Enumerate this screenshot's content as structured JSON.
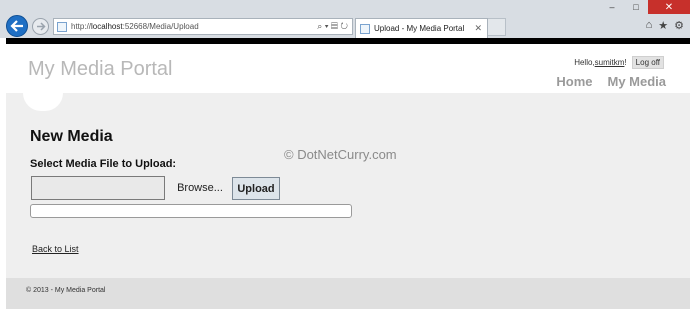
{
  "browser": {
    "url_prefix": "http://",
    "url_host": "localhost",
    "url_rest": ":52668/Media/Upload",
    "tab_title": "Upload - My Media Portal",
    "tab_close": "✕",
    "addr_tools": "⌕ ▾ ▤ ↻",
    "win_min": "–",
    "win_max": "□",
    "win_close": "✕",
    "icon_home": "⌂",
    "icon_star": "★",
    "icon_gear": "⚙"
  },
  "site": {
    "title": "My Media Portal",
    "greeting": "Hello, ",
    "user": "sumitkm",
    "greeting_end": "!",
    "logoff": "Log off",
    "nav": [
      "Home",
      "My Media"
    ]
  },
  "main": {
    "heading": "New Media",
    "file_label": "Select Media File to Upload:",
    "browse_label": "Browse...",
    "upload_label": "Upload",
    "progress_fraction": 0,
    "back_link": "Back to List",
    "watermark": "© DotNetCurry.com"
  },
  "footer": {
    "text": "© 2013 - My Media Portal"
  }
}
